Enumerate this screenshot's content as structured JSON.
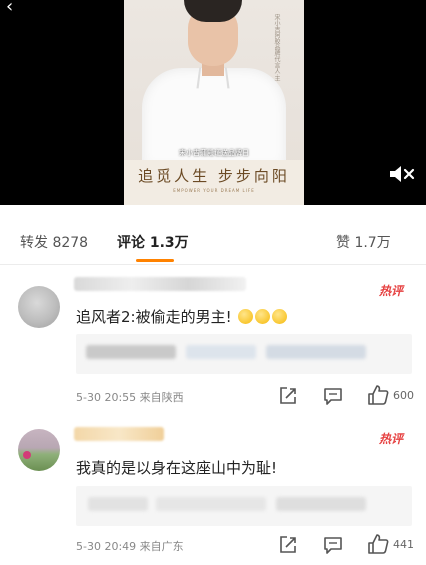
{
  "video": {
    "subtitle": "宋小吉蒲殿证送品牌日",
    "side_text": "宋小吉阿胶品牌代言人·王",
    "slogan": "追觅人生 步步向阳",
    "slogan_en": "EMPOWER YOUR DREAM LIFE"
  },
  "tabs": {
    "repost": "转发 8278",
    "comment": "评论 1.3万",
    "like": "赞 1.7万"
  },
  "colors": {
    "accent": "#ff8200",
    "hot_badge": "#e64141"
  },
  "comments": [
    {
      "hot_label": "热评",
      "text": "追风者2:被偷走的男主!",
      "emoji_count": 3,
      "meta": "5-30 20:55 来自陕西",
      "likes": "600"
    },
    {
      "hot_label": "热评",
      "text": "我真的是以身在这座山中为耻!",
      "meta": "5-30 20:49 来自广东",
      "likes": "441"
    }
  ]
}
